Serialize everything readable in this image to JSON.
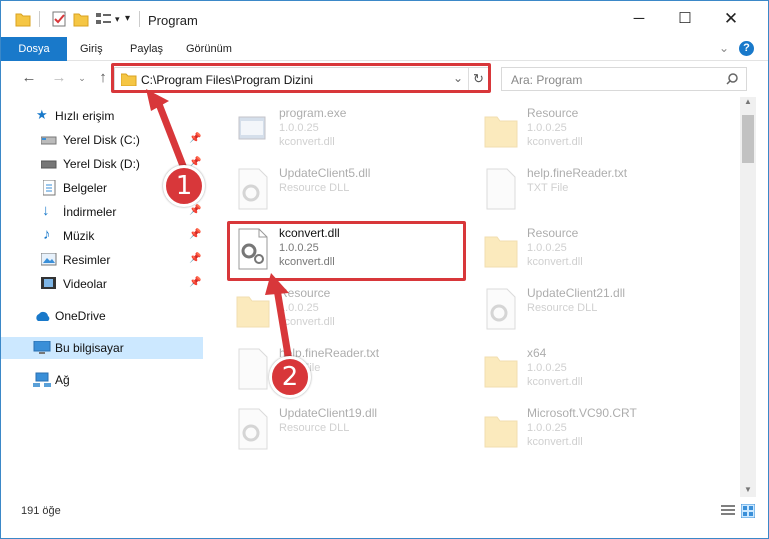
{
  "window": {
    "title": "Program"
  },
  "ribbon": {
    "tabs": [
      "Dosya",
      "Giriş",
      "Paylaş",
      "Görünüm"
    ]
  },
  "address": {
    "path": "C:\\Program Files\\Program Dizini"
  },
  "search": {
    "placeholder": "Ara: Program"
  },
  "sidebar": {
    "items": [
      {
        "label": "Hızlı erişim"
      },
      {
        "label": "Yerel Disk (C:)"
      },
      {
        "label": "Yerel Disk (D:)"
      },
      {
        "label": "Belgeler"
      },
      {
        "label": "İndirmeler"
      },
      {
        "label": "Müzik"
      },
      {
        "label": "Resimler"
      },
      {
        "label": "Videolar"
      },
      {
        "label": "OneDrive"
      },
      {
        "label": "Bu bilgisayar"
      },
      {
        "label": "Ağ"
      }
    ]
  },
  "files": [
    {
      "name": "program.exe",
      "line1": "1.0.0.25",
      "line2": "kconvert.dll"
    },
    {
      "name": "Resource",
      "line1": "1.0.0.25",
      "line2": "kconvert.dll"
    },
    {
      "name": "UpdateClient5.dll",
      "line1": "Resource DLL",
      "line2": ""
    },
    {
      "name": "help.fineReader.txt",
      "line1": "TXT File",
      "line2": ""
    },
    {
      "name": "kconvert.dll",
      "line1": "1.0.0.25",
      "line2": "kconvert.dll"
    },
    {
      "name": "Resource",
      "line1": "1.0.0.25",
      "line2": "kconvert.dll"
    },
    {
      "name": "Resource",
      "line1": "1.0.0.25",
      "line2": "kconvert.dll"
    },
    {
      "name": "UpdateClient21.dll",
      "line1": "Resource DLL",
      "line2": ""
    },
    {
      "name": "help.fineReader.txt",
      "line1": "TXT File",
      "line2": ""
    },
    {
      "name": "x64",
      "line1": "1.0.0.25",
      "line2": "kconvert.dll"
    },
    {
      "name": "UpdateClient19.dll",
      "line1": "Resource DLL",
      "line2": ""
    },
    {
      "name": "Microsoft.VC90.CRT",
      "line1": "1.0.0.25",
      "line2": "kconvert.dll"
    }
  ],
  "status": {
    "count": "191 öğe"
  },
  "annotations": {
    "step1": "1",
    "step2": "2",
    "color": "#d8373a"
  }
}
